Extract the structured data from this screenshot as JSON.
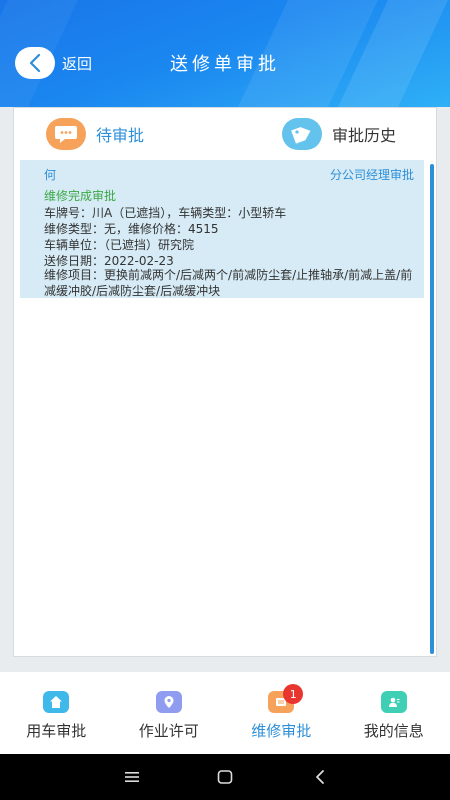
{
  "header": {
    "back_label": "返回",
    "title": "送修单审批"
  },
  "tabs": [
    {
      "label": "待审批",
      "icon": "chat-bubble-icon",
      "active": true
    },
    {
      "label": "审批历史",
      "icon": "tag-icon",
      "active": false
    }
  ],
  "records": [
    {
      "applicant": "何",
      "approval_role": "分公司经理审批",
      "status": "维修完成审批",
      "plate_line": "车牌号：川A（已遮挡），车辆类型：小型轿车",
      "repair_line": "维修类型：无，维修价格：4515",
      "unit_line": "车辆单位：（已遮挡）研究院",
      "date_line": "送修日期：2022-02-23",
      "items_line": "维修项目：更换前减两个/后减两个/前减防尘套/止推轴承/前减上盖/前减缓冲胶/后减防尘套/后减缓冲块"
    }
  ],
  "bottom_nav": [
    {
      "label": "用车审批",
      "icon": "home-icon",
      "color": "#3fb8ea",
      "active": false
    },
    {
      "label": "作业许可",
      "icon": "location-pin-icon",
      "color": "#8f9cf0",
      "active": false
    },
    {
      "label": "维修审批",
      "icon": "repair-doc-icon",
      "color": "#f6a25a",
      "active": true,
      "badge": "1"
    },
    {
      "label": "我的信息",
      "icon": "user-card-icon",
      "color": "#3fcfb5",
      "active": false
    }
  ],
  "colors": {
    "accent": "#2d8fd8",
    "status_green": "#3aa845",
    "card_bg": "#d6ebf5",
    "badge_red": "#e8362f"
  }
}
